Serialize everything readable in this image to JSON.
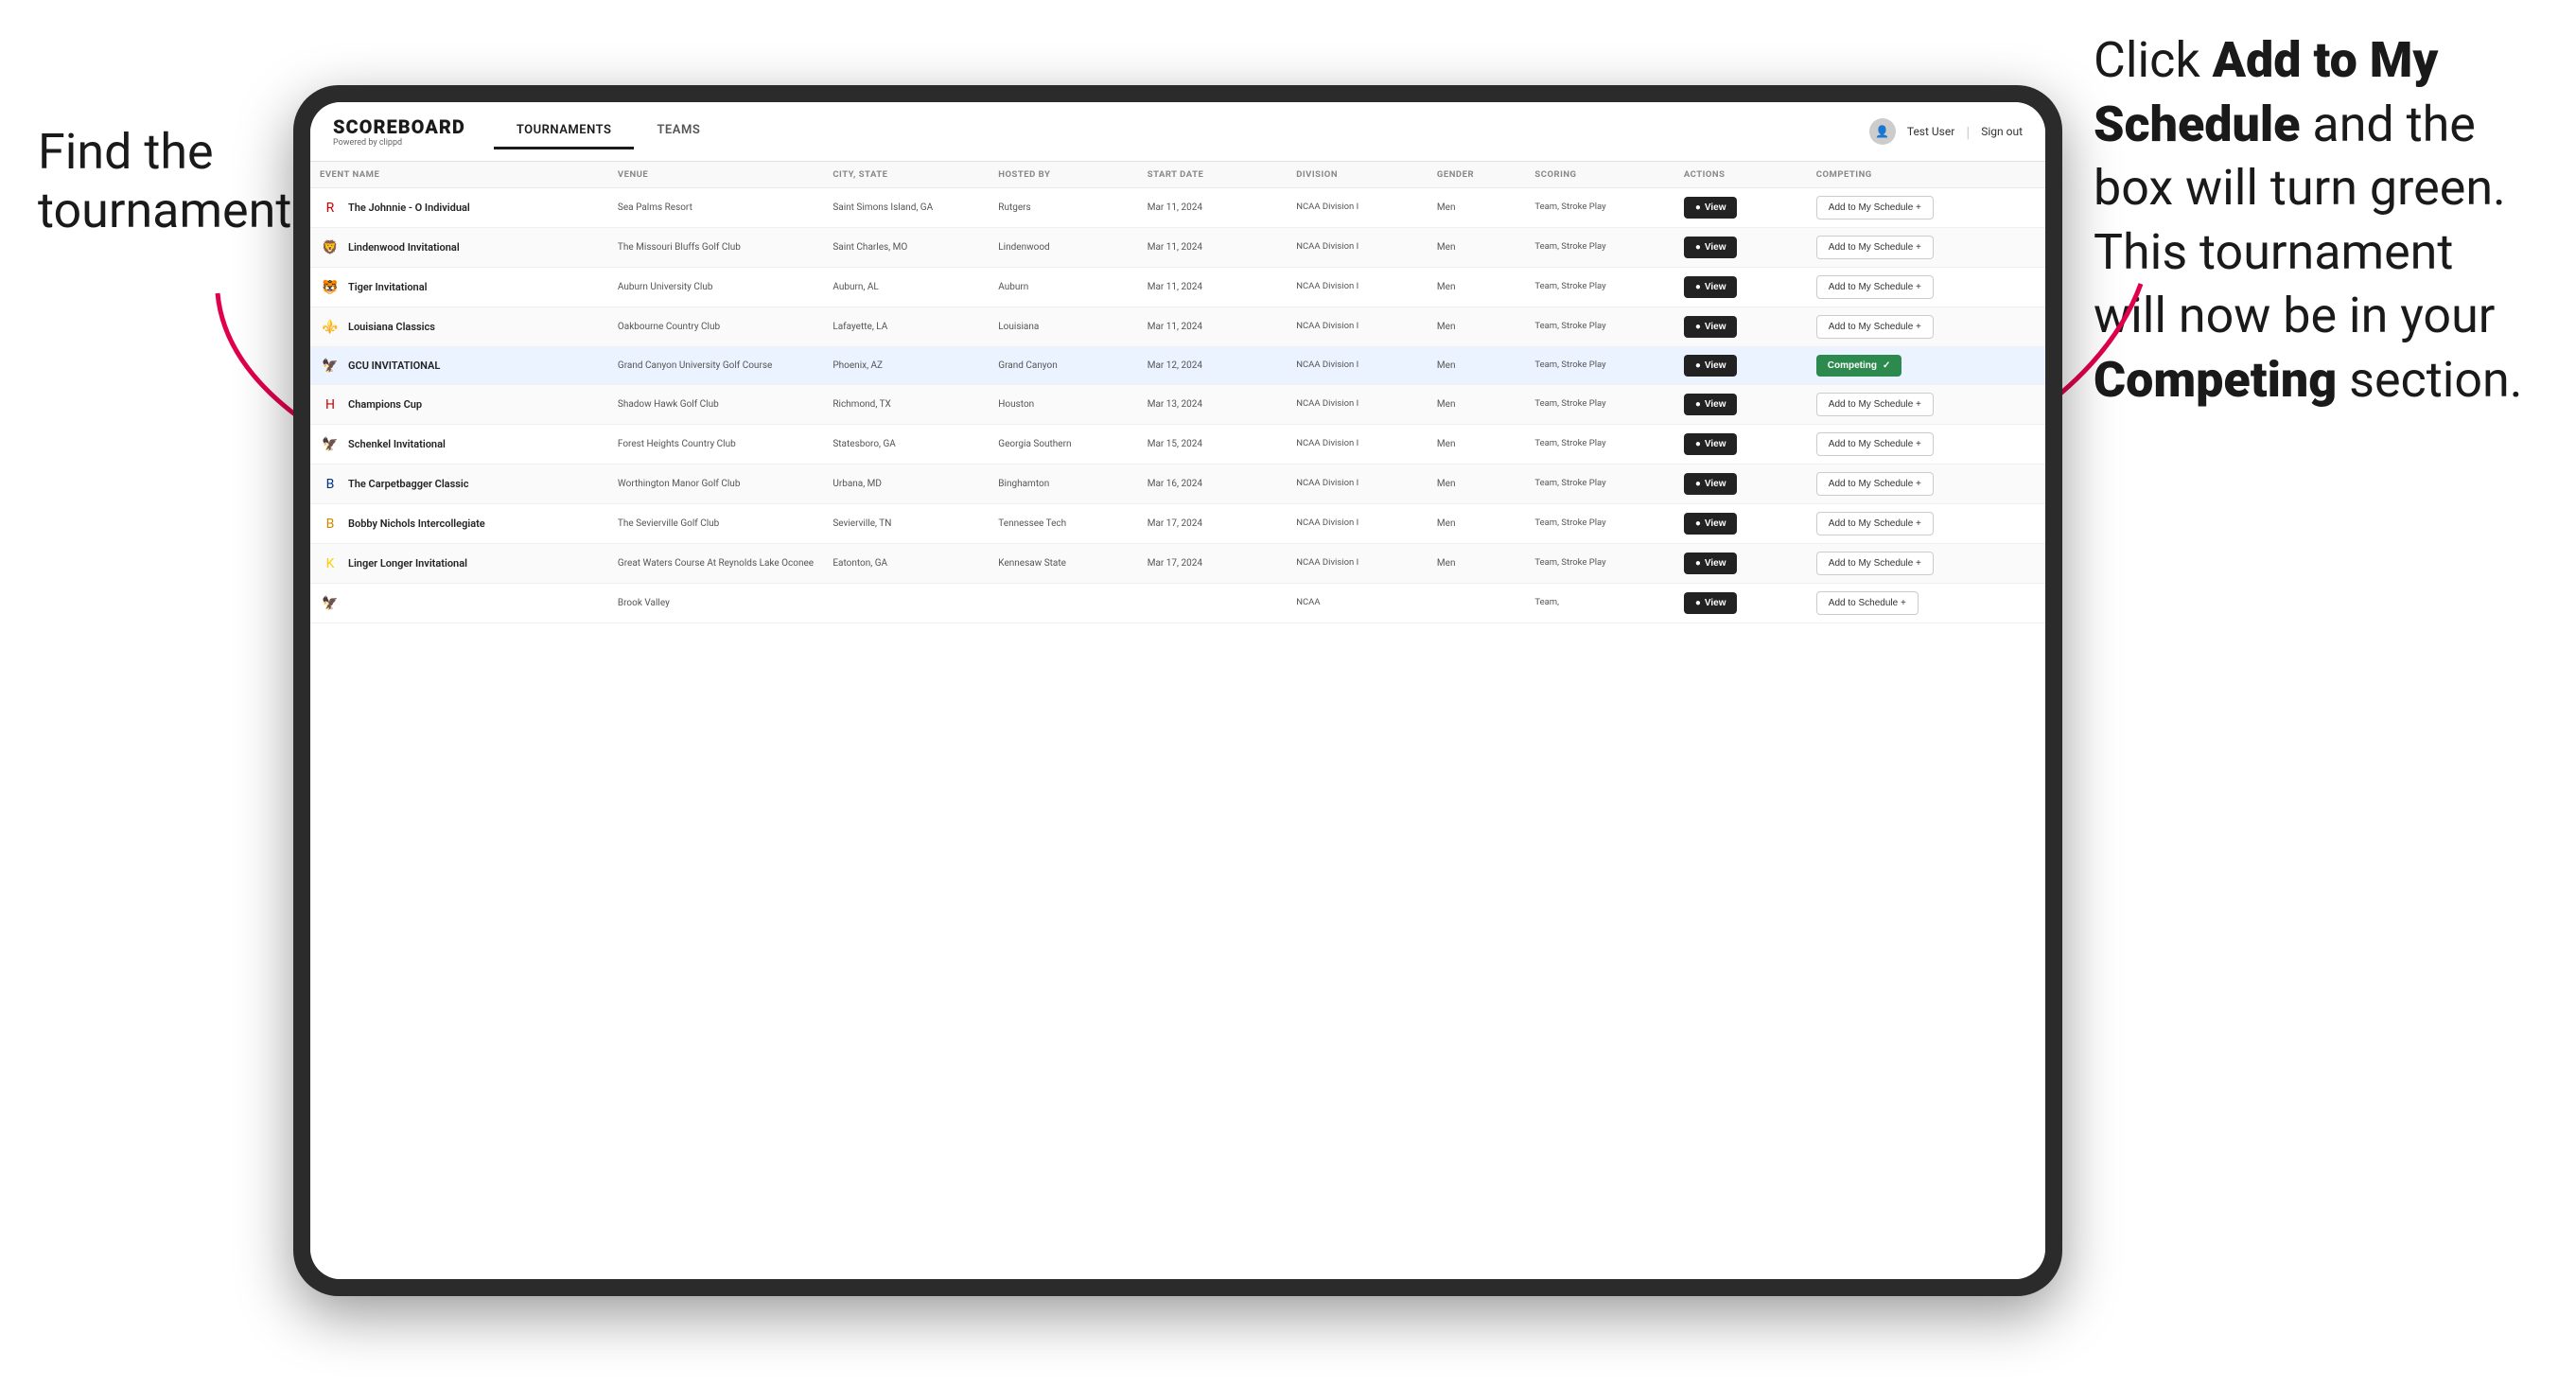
{
  "annotations": {
    "left": "Find the\ntournament.",
    "right_line1": "Click ",
    "right_bold1": "Add to My\nSchedule",
    "right_line2": " and the\nbox will turn green.\nThis tournament\nwill now be in\nyour ",
    "right_bold2": "Competing",
    "right_line3": "\nsection."
  },
  "header": {
    "logo": "SCOREBOARD",
    "logo_sub": "Powered by clippd",
    "tabs": [
      "TOURNAMENTS",
      "TEAMS"
    ],
    "active_tab": "TOURNAMENTS",
    "user": "Test User",
    "sign_out": "Sign out"
  },
  "table": {
    "columns": [
      "EVENT NAME",
      "VENUE",
      "CITY, STATE",
      "HOSTED BY",
      "START DATE",
      "DIVISION",
      "GENDER",
      "SCORING",
      "ACTIONS",
      "COMPETING"
    ],
    "rows": [
      {
        "logo": "R",
        "logo_color": "#cc0000",
        "name": "The Johnnie - O Individual",
        "venue": "Sea Palms Resort",
        "city": "Saint Simons Island, GA",
        "hosted": "Rutgers",
        "date": "Mar 11, 2024",
        "division": "NCAA Division I",
        "gender": "Men",
        "scoring": "Team, Stroke Play",
        "action_label": "View",
        "competing_label": "Add to My Schedule +",
        "competing_state": "add",
        "highlighted": false
      },
      {
        "logo": "🦁",
        "logo_color": "#333",
        "name": "Lindenwood Invitational",
        "venue": "The Missouri Bluffs Golf Club",
        "city": "Saint Charles, MO",
        "hosted": "Lindenwood",
        "date": "Mar 11, 2024",
        "division": "NCAA Division I",
        "gender": "Men",
        "scoring": "Team, Stroke Play",
        "action_label": "View",
        "competing_label": "Add to My Schedule +",
        "competing_state": "add",
        "highlighted": false
      },
      {
        "logo": "🐯",
        "logo_color": "#ff8800",
        "name": "Tiger Invitational",
        "venue": "Auburn University Club",
        "city": "Auburn, AL",
        "hosted": "Auburn",
        "date": "Mar 11, 2024",
        "division": "NCAA Division I",
        "gender": "Men",
        "scoring": "Team, Stroke Play",
        "action_label": "View",
        "competing_label": "Add to My Schedule +",
        "competing_state": "add",
        "highlighted": false
      },
      {
        "logo": "⚜️",
        "logo_color": "#8b0000",
        "name": "Louisiana Classics",
        "venue": "Oakbourne Country Club",
        "city": "Lafayette, LA",
        "hosted": "Louisiana",
        "date": "Mar 11, 2024",
        "division": "NCAA Division I",
        "gender": "Men",
        "scoring": "Team, Stroke Play",
        "action_label": "View",
        "competing_label": "Add to My Schedule +",
        "competing_state": "add",
        "highlighted": false
      },
      {
        "logo": "🦅",
        "logo_color": "#003087",
        "name": "GCU INVITATIONAL",
        "venue": "Grand Canyon University Golf Course",
        "city": "Phoenix, AZ",
        "hosted": "Grand Canyon",
        "date": "Mar 12, 2024",
        "division": "NCAA Division I",
        "gender": "Men",
        "scoring": "Team, Stroke Play",
        "action_label": "View",
        "competing_label": "Competing ✓",
        "competing_state": "competing",
        "highlighted": true
      },
      {
        "logo": "H",
        "logo_color": "#cc0000",
        "name": "Champions Cup",
        "venue": "Shadow Hawk Golf Club",
        "city": "Richmond, TX",
        "hosted": "Houston",
        "date": "Mar 13, 2024",
        "division": "NCAA Division I",
        "gender": "Men",
        "scoring": "Team, Stroke Play",
        "action_label": "View",
        "competing_label": "Add to My Schedule +",
        "competing_state": "add",
        "highlighted": false
      },
      {
        "logo": "🦅",
        "logo_color": "#004080",
        "name": "Schenkel Invitational",
        "venue": "Forest Heights Country Club",
        "city": "Statesboro, GA",
        "hosted": "Georgia Southern",
        "date": "Mar 15, 2024",
        "division": "NCAA Division I",
        "gender": "Men",
        "scoring": "Team, Stroke Play",
        "action_label": "View",
        "competing_label": "Add to My Schedule +",
        "competing_state": "add",
        "highlighted": false
      },
      {
        "logo": "B",
        "logo_color": "#003087",
        "name": "The Carpetbagger Classic",
        "venue": "Worthington Manor Golf Club",
        "city": "Urbana, MD",
        "hosted": "Binghamton",
        "date": "Mar 16, 2024",
        "division": "NCAA Division I",
        "gender": "Men",
        "scoring": "Team, Stroke Play",
        "action_label": "View",
        "competing_label": "Add to My Schedule +",
        "competing_state": "add",
        "highlighted": false
      },
      {
        "logo": "B",
        "logo_color": "#cc8800",
        "name": "Bobby Nichols Intercollegiate",
        "venue": "The Sevierville Golf Club",
        "city": "Sevierville, TN",
        "hosted": "Tennessee Tech",
        "date": "Mar 17, 2024",
        "division": "NCAA Division I",
        "gender": "Men",
        "scoring": "Team, Stroke Play",
        "action_label": "View",
        "competing_label": "Add to My Schedule +",
        "competing_state": "add",
        "highlighted": false
      },
      {
        "logo": "K",
        "logo_color": "#ffcc00",
        "name": "Linger Longer Invitational",
        "venue": "Great Waters Course At Reynolds Lake Oconee",
        "city": "Eatonton, GA",
        "hosted": "Kennesaw State",
        "date": "Mar 17, 2024",
        "division": "NCAA Division I",
        "gender": "Men",
        "scoring": "Team, Stroke Play",
        "action_label": "View",
        "competing_label": "Add to My Schedule +",
        "competing_state": "add",
        "highlighted": false
      },
      {
        "logo": "🦅",
        "logo_color": "#555",
        "name": "",
        "venue": "Brook Valley",
        "city": "",
        "hosted": "",
        "date": "",
        "division": "NCAA",
        "gender": "",
        "scoring": "Team,",
        "action_label": "View",
        "competing_label": "Add to Schedule +",
        "competing_state": "add",
        "highlighted": false
      }
    ]
  },
  "buttons": {
    "view_label": "View",
    "add_label": "Add to My Schedule +",
    "competing_label": "Competing ✓"
  }
}
